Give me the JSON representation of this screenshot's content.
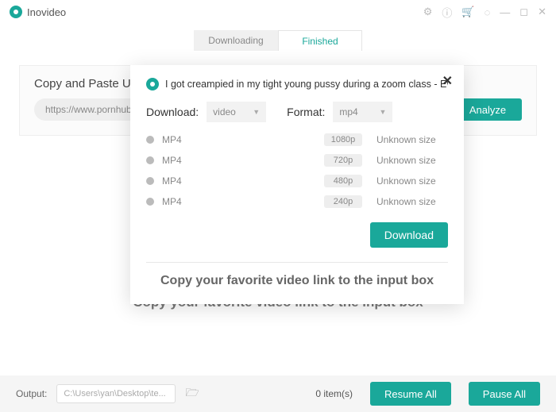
{
  "app": {
    "name": "Inovideo"
  },
  "tabs": {
    "downloading": "Downloading",
    "finished": "Finished"
  },
  "url_section": {
    "label": "Copy and Paste URL here",
    "input_value": "https://www.pornhub.co",
    "analyze": "Analyze"
  },
  "hint": "Copy your favorite video link to the input box",
  "footer": {
    "output_label": "Output:",
    "path": "C:\\Users\\yan\\Desktop\\te...",
    "items": "0 item(s)",
    "resume": "Resume All",
    "pause": "Pause All"
  },
  "modal": {
    "title": "I got creampied in my tight young pussy during a zoom class - Eva Elfie",
    "download_label": "Download:",
    "download_value": "video",
    "format_label": "Format:",
    "format_value": "mp4",
    "rows": [
      {
        "type": "MP4",
        "res": "1080p",
        "size": "Unknown size"
      },
      {
        "type": "MP4",
        "res": "720p",
        "size": "Unknown size"
      },
      {
        "type": "MP4",
        "res": "480p",
        "size": "Unknown size"
      },
      {
        "type": "MP4",
        "res": "240p",
        "size": "Unknown size"
      }
    ],
    "download_btn": "Download",
    "hint": "Copy your favorite video link to the input box"
  }
}
